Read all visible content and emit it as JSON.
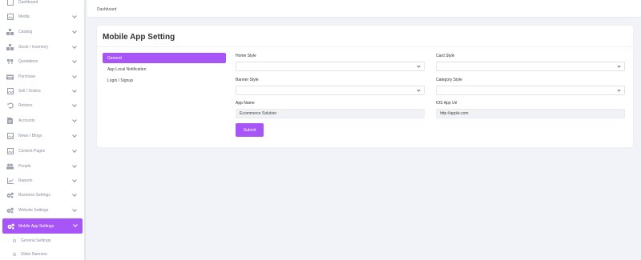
{
  "sidebar": {
    "items": [
      {
        "label": "Dashboard",
        "icon": "dashboard-icon"
      },
      {
        "label": "Media",
        "icon": "image-icon"
      },
      {
        "label": "Catalog",
        "icon": "boxes-icon"
      },
      {
        "label": "Stock / Inventory",
        "icon": "boxes-icon"
      },
      {
        "label": "Quotations",
        "icon": "quote-icon"
      },
      {
        "label": "Purchase",
        "icon": "keyboard-icon"
      },
      {
        "label": "Sell / Orders",
        "icon": "cart-icon"
      },
      {
        "label": "Returns",
        "icon": "undo-icon"
      },
      {
        "label": "Accounts",
        "icon": "document-icon"
      },
      {
        "label": "News / Blogs",
        "icon": "image-icon"
      },
      {
        "label": "Content Pages",
        "icon": "image-icon"
      },
      {
        "label": "People",
        "icon": "people-icon"
      },
      {
        "label": "Reports",
        "icon": "chart-icon"
      },
      {
        "label": "Business Settings",
        "icon": "gears-icon"
      },
      {
        "label": "Website Settings",
        "icon": "gears-icon"
      },
      {
        "label": "Mobile App Settings",
        "icon": "gears-icon"
      }
    ],
    "sub_items": [
      {
        "label": "General Settings"
      },
      {
        "label": "Slider Banners"
      }
    ]
  },
  "topbar": {
    "breadcrumb": "Dashboard"
  },
  "card": {
    "title": "Mobile App Setting",
    "tabs": [
      {
        "label": "General"
      },
      {
        "label": "App Local Notification"
      },
      {
        "label": "Login / Signup"
      }
    ],
    "fields": {
      "home_style": {
        "label": "Home Style",
        "value": ""
      },
      "card_style": {
        "label": "Card Style",
        "value": ""
      },
      "banner_style": {
        "label": "Banner Style",
        "value": ""
      },
      "category_style": {
        "label": "Category Style",
        "value": ""
      },
      "app_name": {
        "label": "App Name",
        "value": "Ecommerce Solution"
      },
      "ios_app_url": {
        "label": "IOS App Url",
        "value": "http://apple.com"
      }
    },
    "submit_label": "Submit"
  },
  "colors": {
    "accent": "#a855f7",
    "background": "#f2f3f8",
    "sidebar_text": "#8a8fa0"
  }
}
